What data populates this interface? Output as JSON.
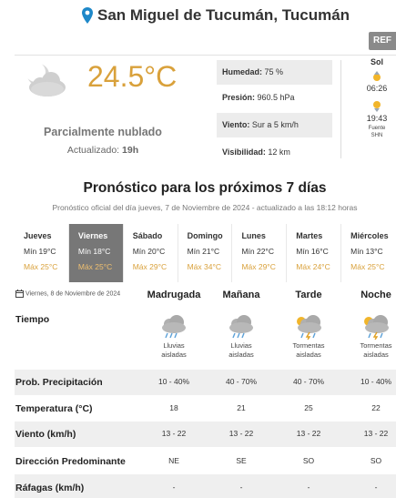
{
  "header": {
    "location": "San Miguel de Tucumán, Tucumán",
    "ref_label": "REF"
  },
  "current": {
    "temperature": "24.5°C",
    "condition": "Parcialmente nublado",
    "updated_label": "Actualizado:",
    "updated_value": "19h",
    "icon": "partly-cloudy-night-icon",
    "details": [
      {
        "label": "Humedad:",
        "value": "75 %"
      },
      {
        "label": "Presión:",
        "value": "960.5 hPa"
      },
      {
        "label": "Viento:",
        "value": "Sur a 5 km/h"
      },
      {
        "label": "Visibilidad:",
        "value": "12 km"
      }
    ],
    "sun": {
      "title": "Sol",
      "sunrise": "06:26",
      "sunset": "19:43",
      "source_line1": "Fuente",
      "source_line2": "SHN"
    }
  },
  "forecast": {
    "title": "Pronóstico para los próximos 7 días",
    "subtitle": "Pronóstico oficial del día jueves, 7 de Noviembre de 2024 - actualizado a las 18:12 horas",
    "days": [
      {
        "name": "Jueves",
        "min": "Mín 19°C",
        "max": "Máx 25°C",
        "active": false
      },
      {
        "name": "Viernes",
        "min": "Mín 18°C",
        "max": "Máx 25°C",
        "active": true
      },
      {
        "name": "Sábado",
        "min": "Mín 20°C",
        "max": "Máx 29°C",
        "active": false
      },
      {
        "name": "Domingo",
        "min": "Mín 21°C",
        "max": "Máx 34°C",
        "active": false
      },
      {
        "name": "Lunes",
        "min": "Mín 22°C",
        "max": "Máx 29°C",
        "active": false
      },
      {
        "name": "Martes",
        "min": "Mín 16°C",
        "max": "Máx 24°C",
        "active": false
      },
      {
        "name": "Miércoles",
        "min": "Mín 13°C",
        "max": "Máx 25°C",
        "active": false
      }
    ]
  },
  "detail": {
    "date": "Viernes, 8 de Noviembre de 2024",
    "periods": [
      "Madrugada",
      "Mañana",
      "Tarde",
      "Noche"
    ],
    "rows": {
      "tiempo": "Tiempo",
      "precip": "Prob. Precipitación",
      "temp": "Temperatura (°C)",
      "viento": "Viento (km/h)",
      "direccion": "Dirección Predominante",
      "rafagas": "Ráfagas (km/h)"
    },
    "weather": [
      {
        "line1": "Lluvias",
        "line2": "aisladas",
        "icon": "rain-cloud-icon"
      },
      {
        "line1": "Lluvias",
        "line2": "aisladas",
        "icon": "rain-cloud-icon"
      },
      {
        "line1": "Tormentas",
        "line2": "aisladas",
        "icon": "storm-cloud-icon"
      },
      {
        "line1": "Tormentas",
        "line2": "aisladas",
        "icon": "storm-cloud-icon"
      }
    ],
    "precip": [
      "10 - 40%",
      "40 - 70%",
      "40 - 70%",
      "10 - 40%"
    ],
    "temp": [
      "18",
      "21",
      "25",
      "22"
    ],
    "viento": [
      "13 - 22",
      "13 - 22",
      "13 - 22",
      "13 - 22"
    ],
    "direccion": [
      "NE",
      "SE",
      "SO",
      "SO"
    ],
    "rafagas": [
      "-",
      "-",
      "-",
      "-"
    ]
  },
  "colors": {
    "accent_temp": "#d9a13b",
    "active_day_bg": "#777777",
    "band": "#efefef"
  }
}
